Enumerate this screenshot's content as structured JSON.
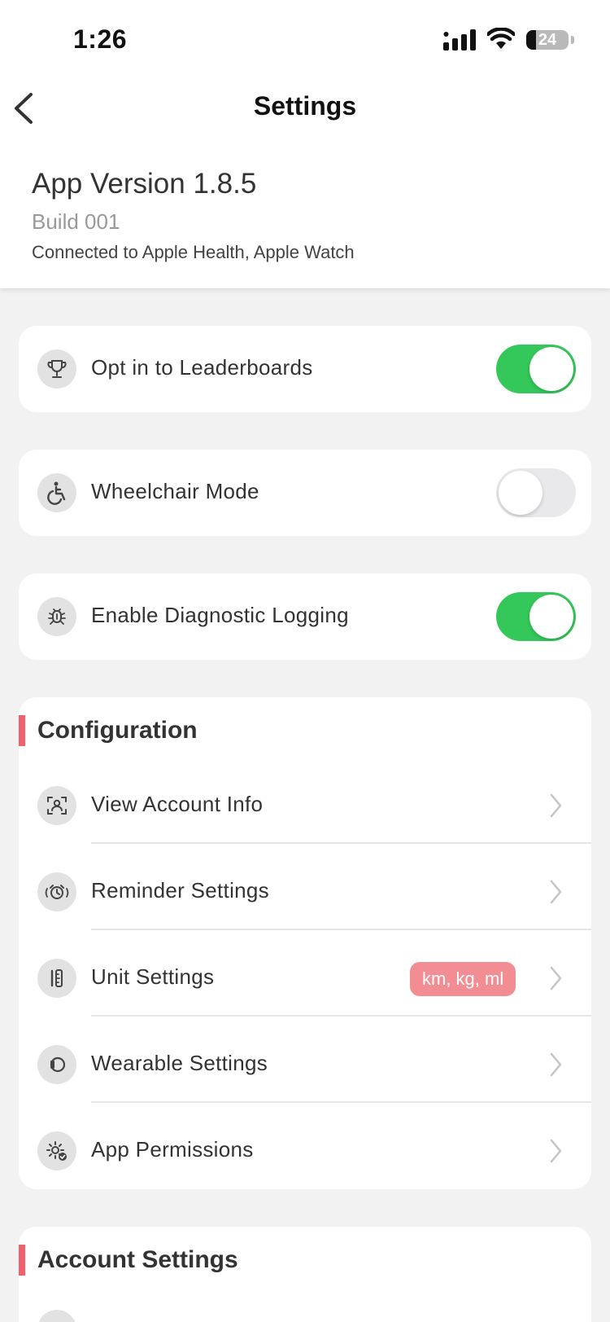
{
  "status_bar": {
    "time": "1:26",
    "battery": "24",
    "icons": [
      "signal-icon",
      "wifi-icon",
      "battery-icon"
    ]
  },
  "nav": {
    "title": "Settings",
    "back_icon": "chevron-left-icon"
  },
  "app_info": {
    "version": "App Version 1.8.5",
    "build": "Build 001",
    "connected": "Connected to Apple Health, Apple Watch"
  },
  "toggles": [
    {
      "label": "Opt in to Leaderboards",
      "icon": "trophy-icon",
      "on": true
    },
    {
      "label": "Wheelchair Mode",
      "icon": "wheelchair-icon",
      "on": false
    },
    {
      "label": "Enable Diagnostic Logging",
      "icon": "bug-icon",
      "on": true
    }
  ],
  "configuration": {
    "title": "Configuration",
    "items": [
      {
        "label": "View Account Info",
        "icon": "account-scan-icon"
      },
      {
        "label": "Reminder Settings",
        "icon": "alarm-icon"
      },
      {
        "label": "Unit Settings",
        "icon": "ruler-icon",
        "badge": "km, kg, ml"
      },
      {
        "label": "Wearable Settings",
        "icon": "watch-icon"
      },
      {
        "label": "App Permissions",
        "icon": "settings-check-icon"
      }
    ]
  },
  "account_settings": {
    "title": "Account Settings"
  },
  "colors": {
    "accent": "#f0616d",
    "badge": "#f38d94",
    "toggle_on": "#34c759",
    "toggle_off": "#e9e9eb",
    "background": "#f2f2f2"
  }
}
